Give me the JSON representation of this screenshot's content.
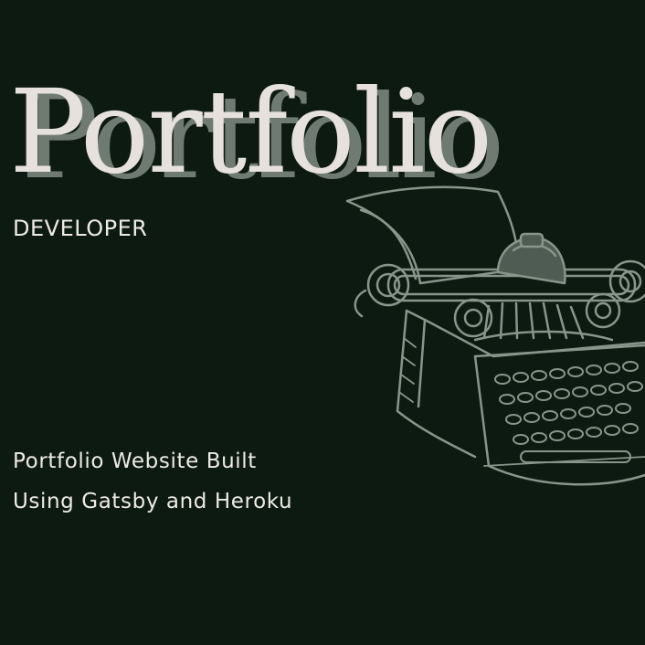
{
  "title": "Portfolio",
  "subtitle": "DEVELOPER",
  "description": {
    "line1": "Portfolio Website Built",
    "line2": "Using Gatsby and Heroku"
  },
  "illustration": {
    "icon": "typewriter-icon"
  },
  "colors": {
    "background": "#0d1a12",
    "title": "#e6e1dc",
    "title_shadow": "#6f7a72",
    "text": "#eeeae6",
    "illustration": "#87968b"
  }
}
